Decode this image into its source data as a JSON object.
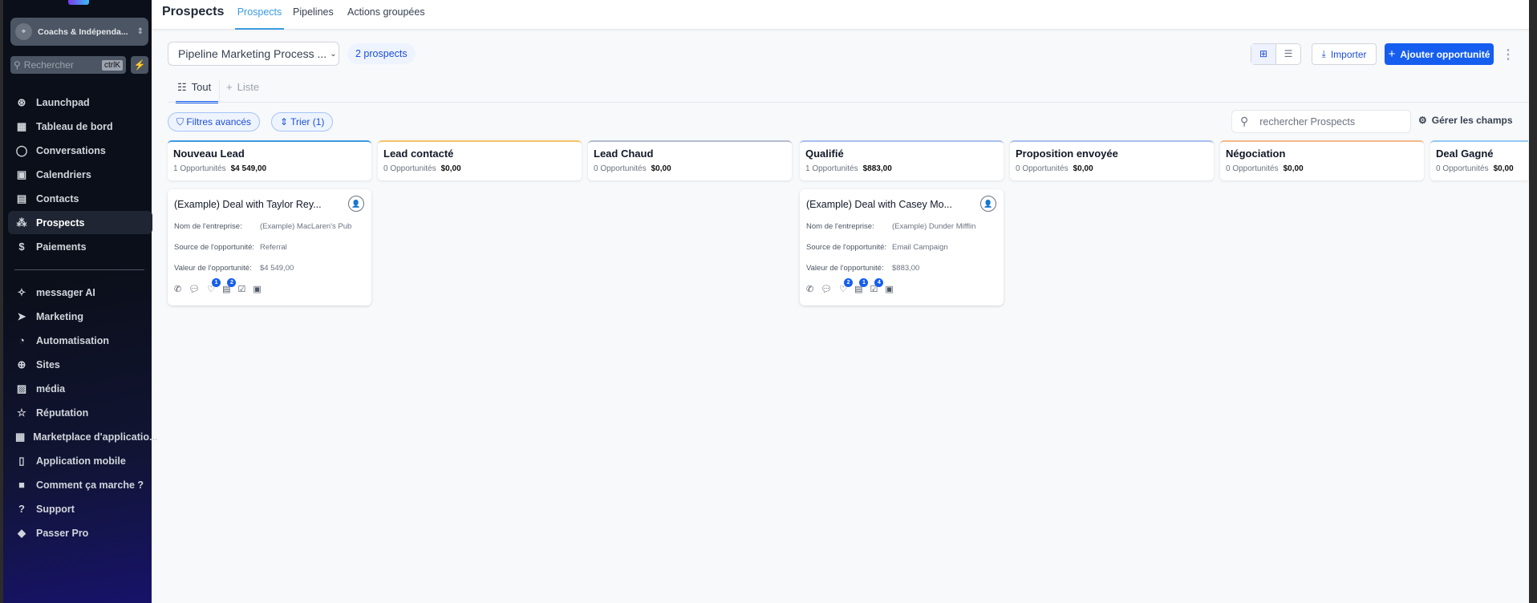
{
  "sidebar": {
    "account": "Coachs & Indépenda...",
    "search_placeholder": "Rechercher",
    "shortcut": "ctrlK",
    "items": [
      {
        "label": "Launchpad",
        "icon": "rocket-icon"
      },
      {
        "label": "Tableau de bord",
        "icon": "dashboard-icon"
      },
      {
        "label": "Conversations",
        "icon": "chat-icon"
      },
      {
        "label": "Calendriers",
        "icon": "calendar-icon"
      },
      {
        "label": "Contacts",
        "icon": "contacts-icon"
      },
      {
        "label": "Prospects",
        "icon": "prospects-icon",
        "active": true
      },
      {
        "label": "Paiements",
        "icon": "payments-icon"
      }
    ],
    "items2": [
      {
        "label": "messager AI",
        "icon": "sparkle-icon"
      },
      {
        "label": "Marketing",
        "icon": "send-icon"
      },
      {
        "label": "Automatisation",
        "icon": "automation-icon"
      },
      {
        "label": "Sites",
        "icon": "globe-icon"
      },
      {
        "label": "média",
        "icon": "image-icon"
      },
      {
        "label": "Réputation",
        "icon": "star-icon"
      },
      {
        "label": "Marketplace d'applicatio...",
        "icon": "apps-icon"
      },
      {
        "label": "Application mobile",
        "icon": "mobile-icon"
      },
      {
        "label": "Comment ça marche ?",
        "icon": "video-icon"
      },
      {
        "label": "Support",
        "icon": "help-icon"
      },
      {
        "label": "Passer Pro",
        "icon": "diamond-icon"
      }
    ]
  },
  "header": {
    "title": "Prospects",
    "tabs": [
      "Prospects",
      "Pipelines",
      "Actions groupées"
    ]
  },
  "toolbar": {
    "pipeline": "Pipeline Marketing Process ...",
    "count": "2 prospects",
    "import": "Importer",
    "add": "Ajouter opportunité"
  },
  "views": {
    "all": "Tout",
    "list": "Liste"
  },
  "filters": {
    "advanced": "Filtres avancés",
    "sort": "Trier (1)",
    "search_placeholder": "rechercher Prospects",
    "manage": "Gérer les champs"
  },
  "stages": [
    {
      "name": "Nouveau Lead",
      "count": "1 Opportunités",
      "value": "$4 549,00",
      "color": "#3b9be0"
    },
    {
      "name": "Lead contacté",
      "count": "0 Opportunités",
      "value": "$0,00",
      "color": "#f5c56b"
    },
    {
      "name": "Lead Chaud",
      "count": "0 Opportunités",
      "value": "$0,00",
      "color": "#b6bcd0"
    },
    {
      "name": "Qualifié",
      "count": "1 Opportunités",
      "value": "$883,00",
      "color": "#a9bff0"
    },
    {
      "name": "Proposition envoyée",
      "count": "0 Opportunités",
      "value": "$0,00",
      "color": "#a9bff0"
    },
    {
      "name": "Négociation",
      "count": "0 Opportunités",
      "value": "$0,00",
      "color": "#f5b98a"
    },
    {
      "name": "Deal Gagné",
      "count": "0 Opportunités",
      "value": "$0,00",
      "color": "#93c9f5"
    }
  ],
  "labels": {
    "company": "Nom de l'entreprise:",
    "source": "Source de l'opportunité:",
    "value": "Valeur de l'opportunité:"
  },
  "cards": [
    {
      "title": "(Example) Deal with Taylor Rey...",
      "company": "(Example) MacLaren's Pub",
      "source": "Referral",
      "value": "$4 549,00",
      "badges": {
        "tag": "1",
        "note": "2"
      }
    },
    {
      "title": "(Example) Deal with Casey Mo...",
      "company": "(Example) Dunder Mifflin",
      "source": "Email Campaign",
      "value": "$883,00",
      "badges": {
        "tag": "2",
        "note": "1",
        "task": "4"
      }
    }
  ]
}
